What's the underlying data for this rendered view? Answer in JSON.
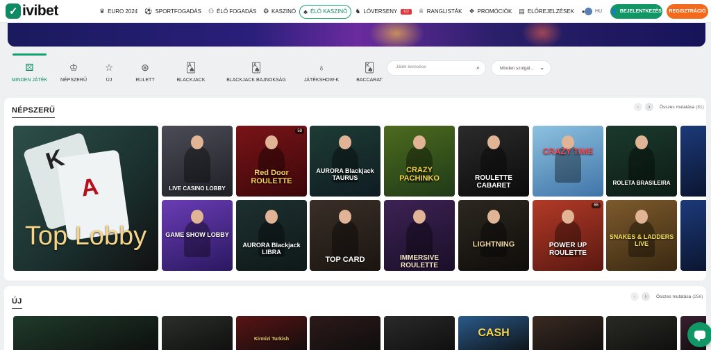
{
  "brand": {
    "name": "ivibet",
    "accent": "#119766",
    "register_color": "#f36a1d"
  },
  "nav": [
    {
      "label": "EURO 2024",
      "icon": "trophy-icon",
      "glyph": "♛"
    },
    {
      "label": "SPORTFOGADÁS",
      "icon": "football-icon",
      "glyph": "⚽"
    },
    {
      "label": "ÉLŐ FOGADÁS",
      "icon": "live-icon",
      "glyph": "⚇"
    },
    {
      "label": "KASZINÓ",
      "icon": "casino-chip-icon",
      "glyph": "❂"
    },
    {
      "label": "ÉLŐ KASZINÓ",
      "icon": "live-casino-icon",
      "glyph": "♣",
      "active": true
    },
    {
      "label": "LÓVERSENY",
      "icon": "horse-icon",
      "glyph": "♞",
      "badge": "ÚJ"
    },
    {
      "label": "RANGLISTÁK",
      "icon": "leaderboard-icon",
      "glyph": "♕"
    },
    {
      "label": "PROMÓCIÓK",
      "icon": "gift-icon",
      "glyph": "❖"
    },
    {
      "label": "ELŐREJELZÉSEK",
      "icon": "predictions-icon",
      "glyph": "▤"
    }
  ],
  "header": {
    "more": "•••",
    "lang": "HU",
    "login": "BEJELENTKEZÉS",
    "register": "REGISZTRÁCIÓ"
  },
  "categories": [
    {
      "label": "MINDEN JÁTÉK",
      "icon": "dice-icon",
      "glyph": "⚄",
      "active": true
    },
    {
      "label": "NÉPSZERŰ",
      "icon": "crown-icon",
      "glyph": "♔"
    },
    {
      "label": "ÚJ",
      "icon": "star-icon",
      "glyph": "☆"
    },
    {
      "label": "RULETT",
      "icon": "roulette-icon",
      "glyph": "⊛"
    },
    {
      "label": "BLACKJACK",
      "icon": "cards-icon",
      "glyph": "🂡"
    },
    {
      "label": "BLACKJACK BAJNOKSÁG",
      "icon": "cards-tournament-icon",
      "glyph": "🂡"
    },
    {
      "label": "JÁTÉKSHOW-K",
      "icon": "microphone-icon",
      "glyph": "♁"
    },
    {
      "label": "BACCARAT",
      "icon": "baccarat-icon",
      "glyph": "🂮"
    }
  ],
  "search": {
    "placeholder": "Játék keresése"
  },
  "provider": {
    "value": "Minden szolgál..."
  },
  "popular": {
    "title": "NÉPSZERŰ",
    "show_all": "Összes mutatása",
    "count": "(81)",
    "tiles": [
      {
        "label": "Top Lobby"
      },
      {
        "label": "LIVE CASINO LOBBY"
      },
      {
        "label": "Red Door ROULETTE",
        "players": "58"
      },
      {
        "label": "AURORA Blackjack TAURUS"
      },
      {
        "label": "CRAZY PACHINKO"
      },
      {
        "label": "ROULETTE CABARET"
      },
      {
        "label": "CRAZY TIME"
      },
      {
        "label": "ROLETA BRASILEIRA"
      },
      {
        "label": "GAME SHOW LOBBY"
      },
      {
        "label": "AURORA Blackjack LIBRA"
      },
      {
        "label": "TOP CARD"
      },
      {
        "label": "IMMERSIVE ROULETTE"
      },
      {
        "label": "LIGHTNING"
      },
      {
        "label": "POWER UP ROULETTE",
        "players": "65"
      },
      {
        "label": "SNAKES & LADDERS LIVE"
      }
    ]
  },
  "new": {
    "title": "ÚJ",
    "show_all": "Összes mutatása",
    "count": "(256)",
    "tiles": [
      {
        "label": "Kirmizi Turkish"
      },
      {
        "label": "CASH"
      }
    ]
  }
}
